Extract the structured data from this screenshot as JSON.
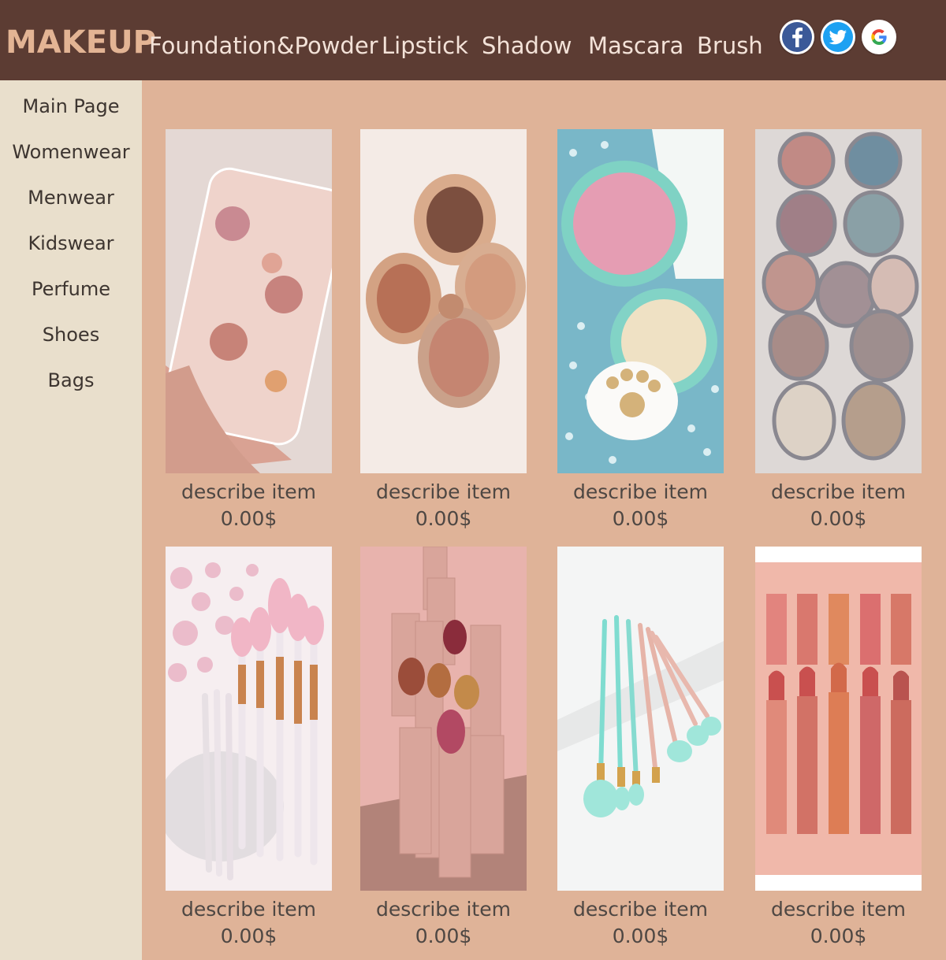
{
  "header": {
    "logo": "MAKEUP",
    "nav": [
      "Foundation&Powder",
      "Lipstick",
      "Shadow",
      "Mascara",
      "Brush"
    ],
    "social": [
      {
        "icon": "facebook-icon",
        "color": "#3b5998"
      },
      {
        "icon": "twitter-icon",
        "color": "#1da1f2"
      },
      {
        "icon": "google-icon",
        "color": "#4285f4"
      }
    ]
  },
  "sidebar": {
    "items": [
      "Main Page",
      "Womenwear",
      "Menwear",
      "Kidswear",
      "Perfume",
      "Shoes",
      "Bags"
    ]
  },
  "products": [
    {
      "image": "resin-rose-block-image",
      "desc": "describe item",
      "price": "0.00$"
    },
    {
      "image": "bronzer-compacts-image",
      "desc": "describe item",
      "price": "0.00$"
    },
    {
      "image": "paw-powder-compact-image",
      "desc": "describe item",
      "price": "0.00$"
    },
    {
      "image": "eyeshadow-compacts-image",
      "desc": "describe item",
      "price": "0.00$"
    },
    {
      "image": "sakura-brush-set-image",
      "desc": "describe item",
      "price": "0.00$"
    },
    {
      "image": "lipstick-tower-image",
      "desc": "describe item",
      "price": "0.00$"
    },
    {
      "image": "mint-brush-fan-image",
      "desc": "describe item",
      "price": "0.00$"
    },
    {
      "image": "lipstick-row-image",
      "desc": "describe item",
      "price": "0.00$"
    }
  ],
  "colors": {
    "topbar": "#5c3c33",
    "logo": "#e3b494",
    "content_bg": "#dfb398",
    "sidebar_bg": "#e9dfcc"
  }
}
